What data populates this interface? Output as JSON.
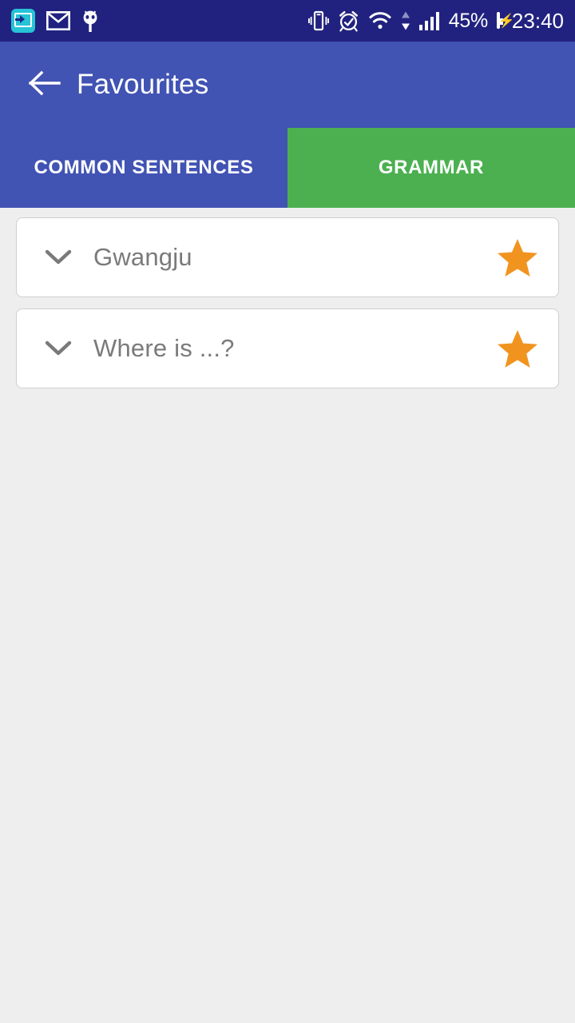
{
  "status_bar": {
    "background": "#21227f",
    "left_icons": [
      {
        "name": "screen-cast-icon",
        "label": "cast"
      },
      {
        "name": "gmail-icon",
        "label": "gmail"
      },
      {
        "name": "bug-droid-icon",
        "label": "debug"
      }
    ],
    "right_icons": [
      {
        "name": "vibrate-icon",
        "label": "vibrate"
      },
      {
        "name": "alarm-clock-icon",
        "label": "alarm"
      },
      {
        "name": "wifi-icon",
        "label": "wifi"
      },
      {
        "name": "data-transfer-icon",
        "label": "data up/down"
      },
      {
        "name": "signal-bars-icon",
        "label": "signal"
      }
    ],
    "battery_percent": "45%",
    "battery_level": 45,
    "battery_charging": true,
    "clock": "23:40"
  },
  "app_bar": {
    "background": "#4153b3",
    "back_icon": "arrow-left-icon",
    "title": "Favourites"
  },
  "tabs": {
    "active_index": 1,
    "inactive_color": "#4153b3",
    "active_color": "#4cb050",
    "items": [
      {
        "label": "COMMON SENTENCES",
        "active": false
      },
      {
        "label": "GRAMMAR",
        "active": true
      }
    ]
  },
  "list": {
    "star_color": "#f1941f",
    "chevron_color": "#7a7a7a",
    "items": [
      {
        "label": "Gwangju",
        "expand_icon": "chevron-down-icon",
        "favourite_icon": "star-filled-icon",
        "favourite": true
      },
      {
        "label": "Where is ...?",
        "expand_icon": "chevron-down-icon",
        "favourite_icon": "star-filled-icon",
        "favourite": true
      }
    ]
  },
  "page_background": "#eeeeee"
}
